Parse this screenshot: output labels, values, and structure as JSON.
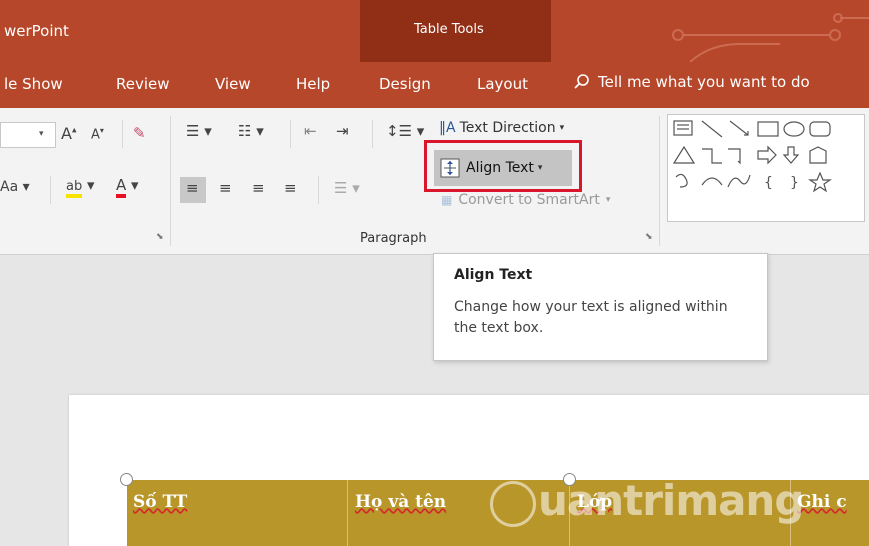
{
  "window": {
    "title": "werPoint"
  },
  "context": {
    "title": "Table Tools"
  },
  "tabs": [
    "le Show",
    "Review",
    "View",
    "Help",
    "Design",
    "Layout"
  ],
  "tell_me": {
    "label": "Tell me what you want to do",
    "icon": "search-icon"
  },
  "ribbon": {
    "paragraph_group_label": "Paragraph",
    "text_direction_label": "Text Direction",
    "align_text_label": "Align Text",
    "convert_smartart_label": "Convert to SmartArt",
    "font_partial_label": "Aa",
    "shapes_icon": "shapes-gallery-icon"
  },
  "tooltip": {
    "title": "Align Text",
    "description": "Change how your text is aligned within the text box."
  },
  "table": {
    "headers": [
      "Số TT",
      "Họ và tên",
      "Lớp",
      "Ghi c"
    ]
  },
  "watermark": {
    "text": "uantrimang"
  },
  "colors": {
    "accent": "#b7472a",
    "context_tab": "#912f16",
    "highlight": "#d9162b",
    "table_header": "#b8962a"
  }
}
